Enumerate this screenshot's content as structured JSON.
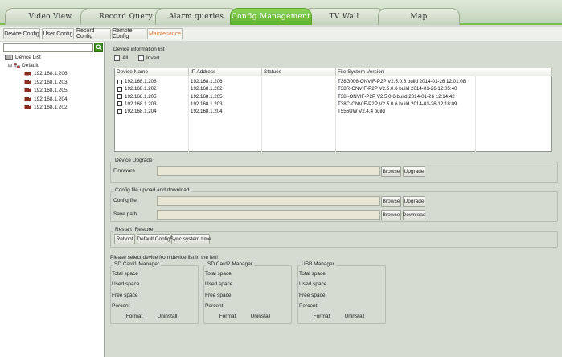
{
  "top_tabs": [
    {
      "label": "Video View"
    },
    {
      "label": "Record Query"
    },
    {
      "label": "Alarm queries"
    },
    {
      "label": "Config Management"
    },
    {
      "label": "TV Wall"
    },
    {
      "label": "Map"
    }
  ],
  "sub_tabs": [
    {
      "label": "Device Config"
    },
    {
      "label": "User Config"
    },
    {
      "label": "Record Config"
    },
    {
      "label": "Remote Config"
    },
    {
      "label": "Maintenance"
    }
  ],
  "sidebar": {
    "root_label": "Device List",
    "group_label": "Default",
    "devices": [
      "192.168.1.206",
      "192.168.1.203",
      "192.168.1.205",
      "192.168.1.204",
      "192.168.1.202"
    ]
  },
  "device_info": {
    "title": "Device information list",
    "all_label": "All",
    "invert_label": "Invert",
    "columns": [
      "Device Name",
      "IP Address",
      "Statues",
      "File System Version"
    ],
    "rows": [
      {
        "name": "192.168.1.206",
        "ip": "192.168.1.206",
        "status": "",
        "version": "T38G006-ONVIF-P2P V2.5.0.6 build 2014-01-26 12:01:08"
      },
      {
        "name": "192.168.1.202",
        "ip": "192.168.1.202",
        "status": "",
        "version": "T38R-ONVIF-P2P V2.5.0.6 build 2014-01-26 12:05:40"
      },
      {
        "name": "192.168.1.205",
        "ip": "192.168.1.205",
        "status": "",
        "version": "T38I-ONVIF-P2P V2.5.0.6 build 2014-01-26 12:14:42"
      },
      {
        "name": "192.168.1.203",
        "ip": "192.168.1.203",
        "status": "",
        "version": "T38C-ONVIF-P2P V2.5.0.6 build 2014-01-26 12:18:09"
      },
      {
        "name": "192.168.1.204",
        "ip": "192.168.1.204",
        "status": "",
        "version": "T556UW V2.4.4 build"
      }
    ]
  },
  "upgrade": {
    "title": "Device Upgrade",
    "firmware_label": "Firmware",
    "browse_label": "Browse",
    "upgrade_label": "Upgrade"
  },
  "config_file": {
    "title": "Config file upload and download",
    "config_label": "Config file",
    "save_label": "Save path",
    "browse_label": "Browse",
    "upgrade_label": "Upgrade",
    "download_label": "Download"
  },
  "restart": {
    "title": "Restart_Restore",
    "reboot_label": "Reboot",
    "default_label": "Default Config",
    "sync_label": "Sync system time"
  },
  "storage": {
    "hint": "Please select device from device list in the left!",
    "managers": [
      {
        "title": "SD Card1 Manager"
      },
      {
        "title": "SD Card2 Manager"
      },
      {
        "title": "USB Manager"
      }
    ],
    "total_label": "Total space",
    "used_label": "Used space",
    "free_label": "Free space",
    "percent_label": "Percent",
    "format_label": "Format",
    "uninstall_label": "Uninstall"
  },
  "colors": {
    "accent": "#7cbf4c",
    "active_subtab": "#e07a3a",
    "device_icon": "#8b2a1e"
  },
  "icons": {
    "search": "search-icon",
    "device": "camera-icon",
    "tree_root": "device-list-icon",
    "tree_group": "group-icon"
  }
}
